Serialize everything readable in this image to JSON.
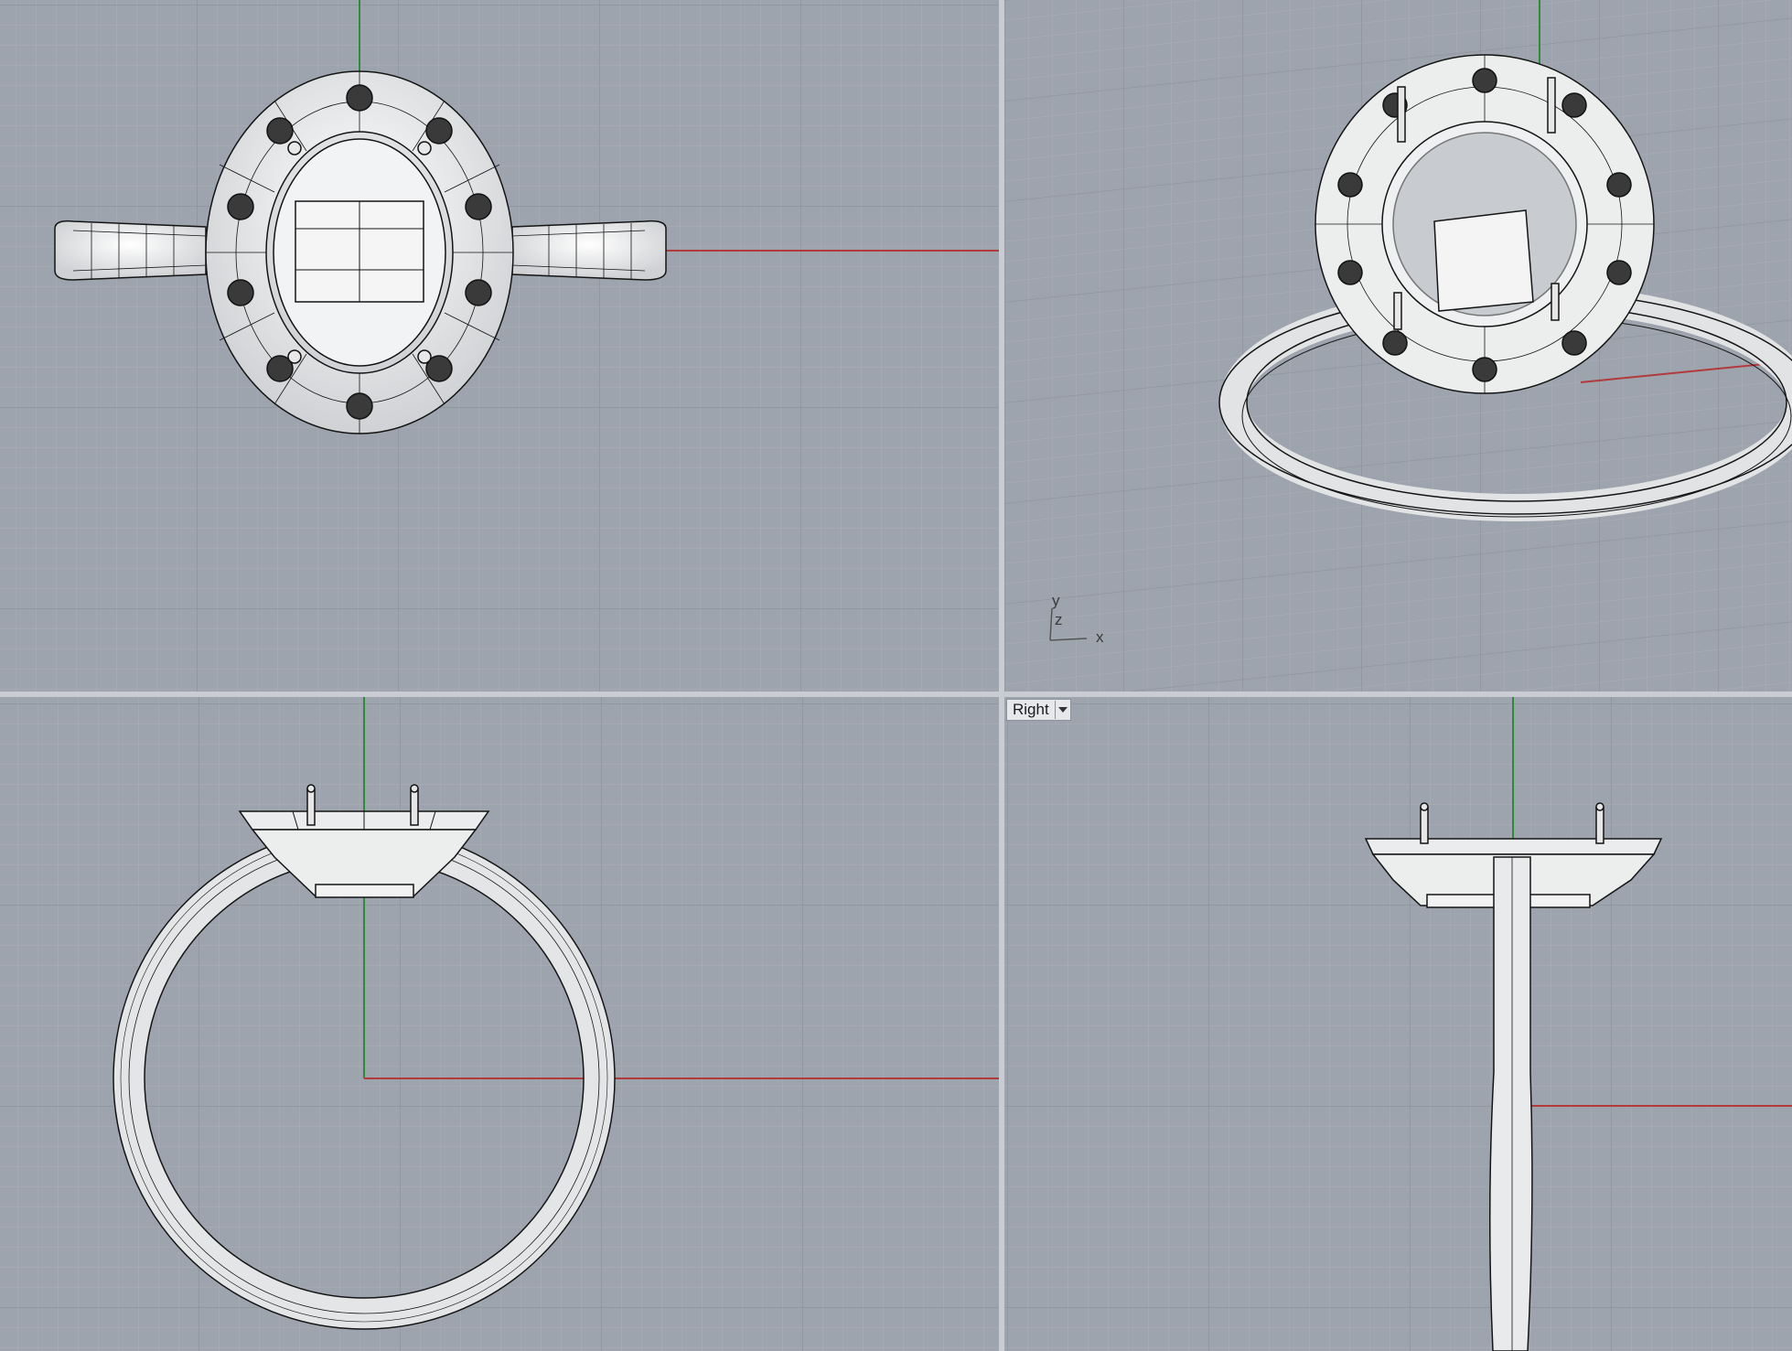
{
  "viewports": {
    "top": {
      "label": ""
    },
    "perspective": {
      "label": "",
      "axis_icon": {
        "y": "y",
        "z": "z",
        "x": "x"
      }
    },
    "front": {
      "label": ""
    },
    "right": {
      "label": "Right"
    }
  },
  "colors": {
    "viewport_bg": "#9ea4ad",
    "grid_minor": "#a9aeb6",
    "grid_major": "#8e939b",
    "x_axis": "#b23a3a",
    "y_axis": "#2f8a3a",
    "model_fill": "#eceded",
    "model_stroke": "#141414"
  }
}
